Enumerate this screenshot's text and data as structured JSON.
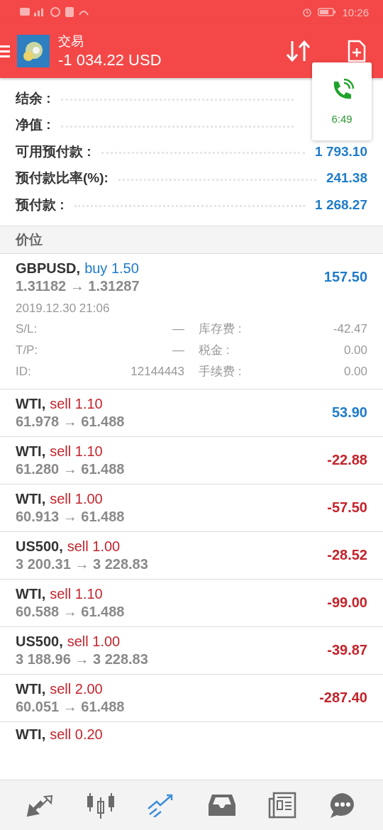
{
  "status_bar": {
    "time": "10:26"
  },
  "header": {
    "title": "交易",
    "subtitle": "-1 034.22 USD"
  },
  "call_overlay": {
    "duration": "6:49"
  },
  "summary": [
    {
      "label": "结余 :"
    },
    {
      "label": "净值 :"
    },
    {
      "label": "可用预付款 :",
      "value": "1 793.10"
    },
    {
      "label": "预付款比率(%):",
      "value": "241.38"
    },
    {
      "label": "预付款 :",
      "value": "1 268.27"
    }
  ],
  "section_title": "价位",
  "positions": [
    {
      "symbol": "GBPUSD,",
      "kind": "buy",
      "order": "buy 1.50",
      "prices": "1.31182 → 1.31287",
      "profit": "157.50",
      "expanded": true,
      "time": "2019.12.30 21:06",
      "details": [
        {
          "label": "S/L:",
          "value": "—",
          "label2": "库存费 :",
          "value2": "-42.47"
        },
        {
          "label": "T/P:",
          "value": "—",
          "label2": "税金 :",
          "value2": "0.00"
        },
        {
          "label": "ID:",
          "value": "12144443",
          "label2": "手续费 :",
          "value2": "0.00"
        }
      ]
    },
    {
      "symbol": "WTI,",
      "kind": "sell",
      "order": "sell 1.10",
      "prices": "61.978 → 61.488",
      "profit": "53.90",
      "expanded": false
    },
    {
      "symbol": "WTI,",
      "kind": "sell",
      "order": "sell 1.10",
      "prices": "61.280 → 61.488",
      "profit": "-22.88",
      "expanded": false
    },
    {
      "symbol": "WTI,",
      "kind": "sell",
      "order": "sell 1.00",
      "prices": "60.913 → 61.488",
      "profit": "-57.50",
      "expanded": false
    },
    {
      "symbol": "US500,",
      "kind": "sell",
      "order": "sell 1.00",
      "prices": "3 200.31 → 3 228.83",
      "profit": "-28.52",
      "expanded": false
    },
    {
      "symbol": "WTI,",
      "kind": "sell",
      "order": "sell 1.10",
      "prices": "60.588 → 61.488",
      "profit": "-99.00",
      "expanded": false
    },
    {
      "symbol": "US500,",
      "kind": "sell",
      "order": "sell 1.00",
      "prices": "3 188.96 → 3 228.83",
      "profit": "-39.87",
      "expanded": false
    },
    {
      "symbol": "WTI,",
      "kind": "sell",
      "order": "sell 2.00",
      "prices": "60.051 → 61.488",
      "profit": "-287.40",
      "expanded": false
    }
  ],
  "partial_row": {
    "symbol": "WTI,",
    "order": "sell 0.20"
  },
  "nav": [
    {
      "kind": "quotes",
      "selected": false
    },
    {
      "kind": "chart",
      "selected": false
    },
    {
      "kind": "trade",
      "selected": true
    },
    {
      "kind": "history",
      "selected": false
    },
    {
      "kind": "news",
      "selected": false
    },
    {
      "kind": "chat",
      "selected": false
    }
  ]
}
